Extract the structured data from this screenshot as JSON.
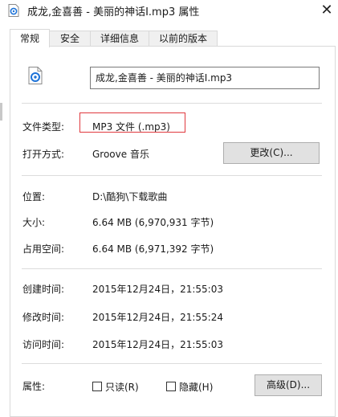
{
  "window": {
    "title": "成龙,金喜善 - 美丽的神话Ⅰ.mp3 属性",
    "close_glyph": "✕"
  },
  "tabs": [
    {
      "label": "常规",
      "active": true
    },
    {
      "label": "安全",
      "active": false
    },
    {
      "label": "详细信息",
      "active": false
    },
    {
      "label": "以前的版本",
      "active": false
    }
  ],
  "general": {
    "file_name": "成龙,金喜善 - 美丽的神话Ⅰ.mp3",
    "file_icon": "audio-file-icon",
    "file_type_label": "文件类型:",
    "file_type_value": "MP3 文件 (.mp3)",
    "open_with_label": "打开方式:",
    "open_with_value": "Groove 音乐",
    "change_button": "更改(C)...",
    "location_label": "位置:",
    "location_value": "D:\\酷狗\\下载歌曲",
    "size_label": "大小:",
    "size_value": "6.64 MB (6,970,931 字节)",
    "size_on_disk_label": "占用空间:",
    "size_on_disk_value": "6.64 MB (6,971,392 字节)",
    "created_label": "创建时间:",
    "created_value": "2015年12月24日，21:55:03",
    "modified_label": "修改时间:",
    "modified_value": "2015年12月24日，21:55:24",
    "accessed_label": "访问时间:",
    "accessed_value": "2015年12月24日，21:55:03",
    "attributes_label": "属性:",
    "readonly_label": "只读(R)",
    "readonly_checked": false,
    "hidden_label": "隐藏(H)",
    "hidden_checked": false,
    "advanced_button": "高级(D)..."
  },
  "colors": {
    "highlight_border": "#e0393e",
    "icon_blue": "#1e73d8"
  }
}
